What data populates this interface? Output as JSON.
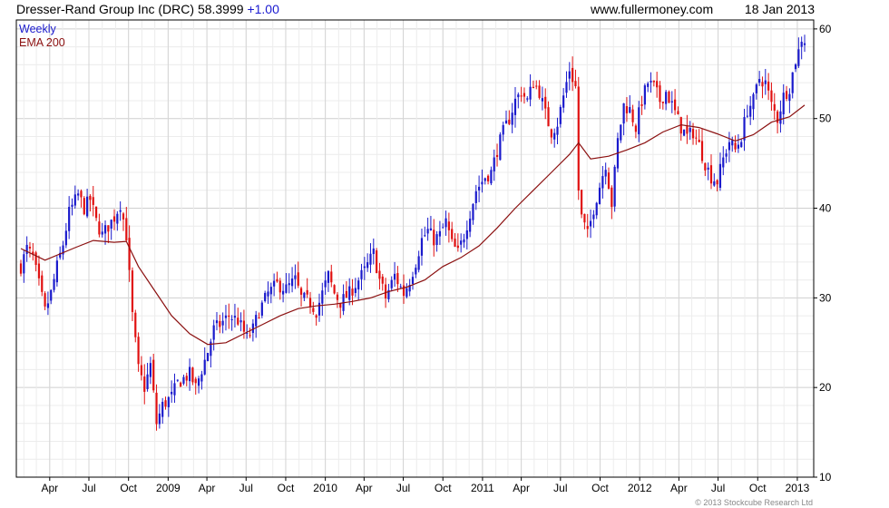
{
  "header": {
    "title": "Dresser-Rand Group Inc (DRC) 58.3999",
    "change": "+1.00",
    "site": "www.fullermoney.com",
    "date": "18 Jan 2013"
  },
  "footer": {
    "copyright": "© 2013 Stockcube Research Ltd"
  },
  "colors": {
    "up": "#1a1acc",
    "down": "#e01010",
    "ema": "#8b1010",
    "grid": "#dcdcdc",
    "frame": "#000000"
  },
  "chart_data": {
    "type": "candlestick",
    "frequency": "Weekly",
    "legend": [
      {
        "label": "Weekly",
        "color": "#1a1acc"
      },
      {
        "label": "EMA 200",
        "color": "#8b1010"
      }
    ],
    "legend_position": "top-left",
    "grid": true,
    "ylim": [
      10,
      61
    ],
    "y_ticks": [
      10,
      20,
      30,
      40,
      50,
      60
    ],
    "y_axis_side": "right",
    "x_range": [
      "2008-01-25",
      "2013-01-18"
    ],
    "x_ticks": [
      {
        "label": "Apr",
        "date": "2008-04-01"
      },
      {
        "label": "Jul",
        "date": "2008-07-01"
      },
      {
        "label": "Oct",
        "date": "2008-10-01"
      },
      {
        "label": "2009",
        "date": "2009-01-01"
      },
      {
        "label": "Apr",
        "date": "2009-04-01"
      },
      {
        "label": "Jul",
        "date": "2009-07-01"
      },
      {
        "label": "Oct",
        "date": "2009-10-01"
      },
      {
        "label": "2010",
        "date": "2010-01-01"
      },
      {
        "label": "Apr",
        "date": "2010-04-01"
      },
      {
        "label": "Jul",
        "date": "2010-07-01"
      },
      {
        "label": "Oct",
        "date": "2010-10-01"
      },
      {
        "label": "2011",
        "date": "2011-01-01"
      },
      {
        "label": "Apr",
        "date": "2011-04-01"
      },
      {
        "label": "Jul",
        "date": "2011-07-01"
      },
      {
        "label": "Oct",
        "date": "2011-10-01"
      },
      {
        "label": "2012",
        "date": "2012-01-01"
      },
      {
        "label": "Apr",
        "date": "2012-04-01"
      },
      {
        "label": "Jul",
        "date": "2012-07-01"
      },
      {
        "label": "Oct",
        "date": "2012-10-01"
      },
      {
        "label": "2013",
        "date": "2013-01-01"
      }
    ],
    "close_path": [
      [
        "2008-01-25",
        33.5
      ],
      [
        "2008-02-08",
        35.5
      ],
      [
        "2008-02-22",
        34.5
      ],
      [
        "2008-03-07",
        31.5
      ],
      [
        "2008-03-21",
        28.5
      ],
      [
        "2008-04-04",
        30.5
      ],
      [
        "2008-04-18",
        33.5
      ],
      [
        "2008-05-02",
        36.0
      ],
      [
        "2008-05-16",
        39.5
      ],
      [
        "2008-06-06",
        41.5
      ],
      [
        "2008-06-20",
        40.0
      ],
      [
        "2008-07-04",
        41.0
      ],
      [
        "2008-07-18",
        38.5
      ],
      [
        "2008-08-01",
        37.0
      ],
      [
        "2008-08-15",
        38.0
      ],
      [
        "2008-08-29",
        39.0
      ],
      [
        "2008-09-12",
        40.5
      ],
      [
        "2008-09-26",
        37.0
      ],
      [
        "2008-10-10",
        28.0
      ],
      [
        "2008-10-24",
        22.0
      ],
      [
        "2008-11-07",
        20.0
      ],
      [
        "2008-11-21",
        22.5
      ],
      [
        "2008-12-05",
        16.0
      ],
      [
        "2008-12-19",
        18.0
      ],
      [
        "2009-01-09",
        19.0
      ],
      [
        "2009-01-23",
        20.5
      ],
      [
        "2009-02-06",
        21.0
      ],
      [
        "2009-02-20",
        21.5
      ],
      [
        "2009-03-06",
        20.0
      ],
      [
        "2009-03-20",
        22.0
      ],
      [
        "2009-04-03",
        24.0
      ],
      [
        "2009-04-17",
        26.5
      ],
      [
        "2009-05-01",
        27.0
      ],
      [
        "2009-05-22",
        28.0
      ],
      [
        "2009-06-12",
        27.5
      ],
      [
        "2009-07-03",
        25.5
      ],
      [
        "2009-07-17",
        26.5
      ],
      [
        "2009-07-31",
        28.5
      ],
      [
        "2009-08-21",
        30.5
      ],
      [
        "2009-09-11",
        31.5
      ],
      [
        "2009-10-02",
        31.0
      ],
      [
        "2009-10-23",
        32.0
      ],
      [
        "2009-11-06",
        30.0
      ],
      [
        "2009-11-27",
        29.5
      ],
      [
        "2009-12-11",
        28.5
      ],
      [
        "2009-12-25",
        30.5
      ],
      [
        "2010-01-08",
        32.5
      ],
      [
        "2010-01-22",
        30.5
      ],
      [
        "2010-02-05",
        29.5
      ],
      [
        "2010-02-26",
        30.5
      ],
      [
        "2010-03-12",
        31.5
      ],
      [
        "2010-04-02",
        33.0
      ],
      [
        "2010-04-23",
        35.0
      ],
      [
        "2010-05-07",
        32.0
      ],
      [
        "2010-05-21",
        30.0
      ],
      [
        "2010-06-11",
        32.5
      ],
      [
        "2010-07-02",
        30.5
      ],
      [
        "2010-07-16",
        32.0
      ],
      [
        "2010-07-30",
        34.0
      ],
      [
        "2010-08-13",
        36.5
      ],
      [
        "2010-08-27",
        37.5
      ],
      [
        "2010-09-10",
        36.5
      ],
      [
        "2010-09-24",
        37.0
      ],
      [
        "2010-10-08",
        38.5
      ],
      [
        "2010-10-22",
        36.0
      ],
      [
        "2010-11-05",
        35.0
      ],
      [
        "2010-11-19",
        37.0
      ],
      [
        "2010-12-03",
        39.5
      ],
      [
        "2010-12-17",
        42.0
      ],
      [
        "2011-01-07",
        43.5
      ],
      [
        "2011-01-21",
        44.0
      ],
      [
        "2011-02-04",
        46.5
      ],
      [
        "2011-02-18",
        48.5
      ],
      [
        "2011-03-04",
        50.0
      ],
      [
        "2011-03-18",
        52.0
      ],
      [
        "2011-04-01",
        53.0
      ],
      [
        "2011-04-15",
        52.0
      ],
      [
        "2011-04-29",
        54.0
      ],
      [
        "2011-05-13",
        53.0
      ],
      [
        "2011-05-27",
        50.5
      ],
      [
        "2011-06-10",
        48.5
      ],
      [
        "2011-06-24",
        49.5
      ],
      [
        "2011-07-08",
        52.5
      ],
      [
        "2011-07-22",
        55.5
      ],
      [
        "2011-08-05",
        53.5
      ],
      [
        "2011-08-12",
        42.0
      ],
      [
        "2011-08-19",
        39.0
      ],
      [
        "2011-09-02",
        37.0
      ],
      [
        "2011-09-16",
        40.0
      ],
      [
        "2011-09-30",
        42.5
      ],
      [
        "2011-10-14",
        45.0
      ],
      [
        "2011-10-28",
        40.5
      ],
      [
        "2011-11-11",
        47.5
      ],
      [
        "2011-11-25",
        51.5
      ],
      [
        "2011-12-09",
        51.0
      ],
      [
        "2011-12-23",
        49.0
      ],
      [
        "2012-01-06",
        52.0
      ],
      [
        "2012-01-20",
        54.0
      ],
      [
        "2012-02-03",
        53.5
      ],
      [
        "2012-02-17",
        52.0
      ],
      [
        "2012-03-02",
        53.0
      ],
      [
        "2012-03-16",
        51.5
      ],
      [
        "2012-04-06",
        49.0
      ],
      [
        "2012-04-20",
        48.0
      ],
      [
        "2012-05-04",
        48.5
      ],
      [
        "2012-05-18",
        47.0
      ],
      [
        "2012-06-01",
        45.0
      ],
      [
        "2012-06-15",
        43.5
      ],
      [
        "2012-06-29",
        43.0
      ],
      [
        "2012-07-13",
        45.5
      ],
      [
        "2012-07-27",
        47.5
      ],
      [
        "2012-08-10",
        46.5
      ],
      [
        "2012-08-24",
        48.0
      ],
      [
        "2012-09-07",
        51.0
      ],
      [
        "2012-09-21",
        52.0
      ],
      [
        "2012-10-05",
        54.5
      ],
      [
        "2012-10-19",
        54.0
      ],
      [
        "2012-11-02",
        51.5
      ],
      [
        "2012-11-16",
        50.0
      ],
      [
        "2012-11-30",
        52.5
      ],
      [
        "2012-12-14",
        53.5
      ],
      [
        "2012-12-28",
        56.5
      ],
      [
        "2013-01-04",
        57.5
      ],
      [
        "2013-01-11",
        59.0
      ],
      [
        "2013-01-18",
        58.4
      ]
    ],
    "ema_200": [
      [
        "2008-01-25",
        35.5
      ],
      [
        "2008-03-21",
        34.2
      ],
      [
        "2008-05-30",
        35.6
      ],
      [
        "2008-07-11",
        36.4
      ],
      [
        "2008-08-29",
        36.2
      ],
      [
        "2008-09-26",
        36.3
      ],
      [
        "2008-10-24",
        33.5
      ],
      [
        "2008-11-28",
        31.0
      ],
      [
        "2009-01-09",
        28.0
      ],
      [
        "2009-02-20",
        26.0
      ],
      [
        "2009-04-03",
        24.8
      ],
      [
        "2009-05-15",
        25.0
      ],
      [
        "2009-06-26",
        26.0
      ],
      [
        "2009-08-07",
        27.0
      ],
      [
        "2009-09-18",
        28.0
      ],
      [
        "2009-10-30",
        28.8
      ],
      [
        "2009-12-11",
        29.1
      ],
      [
        "2010-01-22",
        29.3
      ],
      [
        "2010-03-05",
        29.6
      ],
      [
        "2010-04-16",
        30.0
      ],
      [
        "2010-05-28",
        30.7
      ],
      [
        "2010-07-09",
        31.2
      ],
      [
        "2010-08-20",
        32.0
      ],
      [
        "2010-10-01",
        33.5
      ],
      [
        "2010-11-12",
        34.5
      ],
      [
        "2010-12-24",
        35.8
      ],
      [
        "2011-02-04",
        37.8
      ],
      [
        "2011-03-18",
        40.0
      ],
      [
        "2011-04-29",
        42.0
      ],
      [
        "2011-06-10",
        44.0
      ],
      [
        "2011-07-22",
        46.0
      ],
      [
        "2011-08-12",
        47.3
      ],
      [
        "2011-09-09",
        45.5
      ],
      [
        "2011-10-21",
        45.8
      ],
      [
        "2011-12-02",
        46.5
      ],
      [
        "2012-01-13",
        47.3
      ],
      [
        "2012-02-24",
        48.5
      ],
      [
        "2012-04-06",
        49.3
      ],
      [
        "2012-05-18",
        49.0
      ],
      [
        "2012-06-29",
        48.3
      ],
      [
        "2012-08-10",
        47.5
      ],
      [
        "2012-09-21",
        48.2
      ],
      [
        "2012-11-02",
        49.6
      ],
      [
        "2012-12-14",
        50.2
      ],
      [
        "2013-01-18",
        51.5
      ]
    ]
  }
}
